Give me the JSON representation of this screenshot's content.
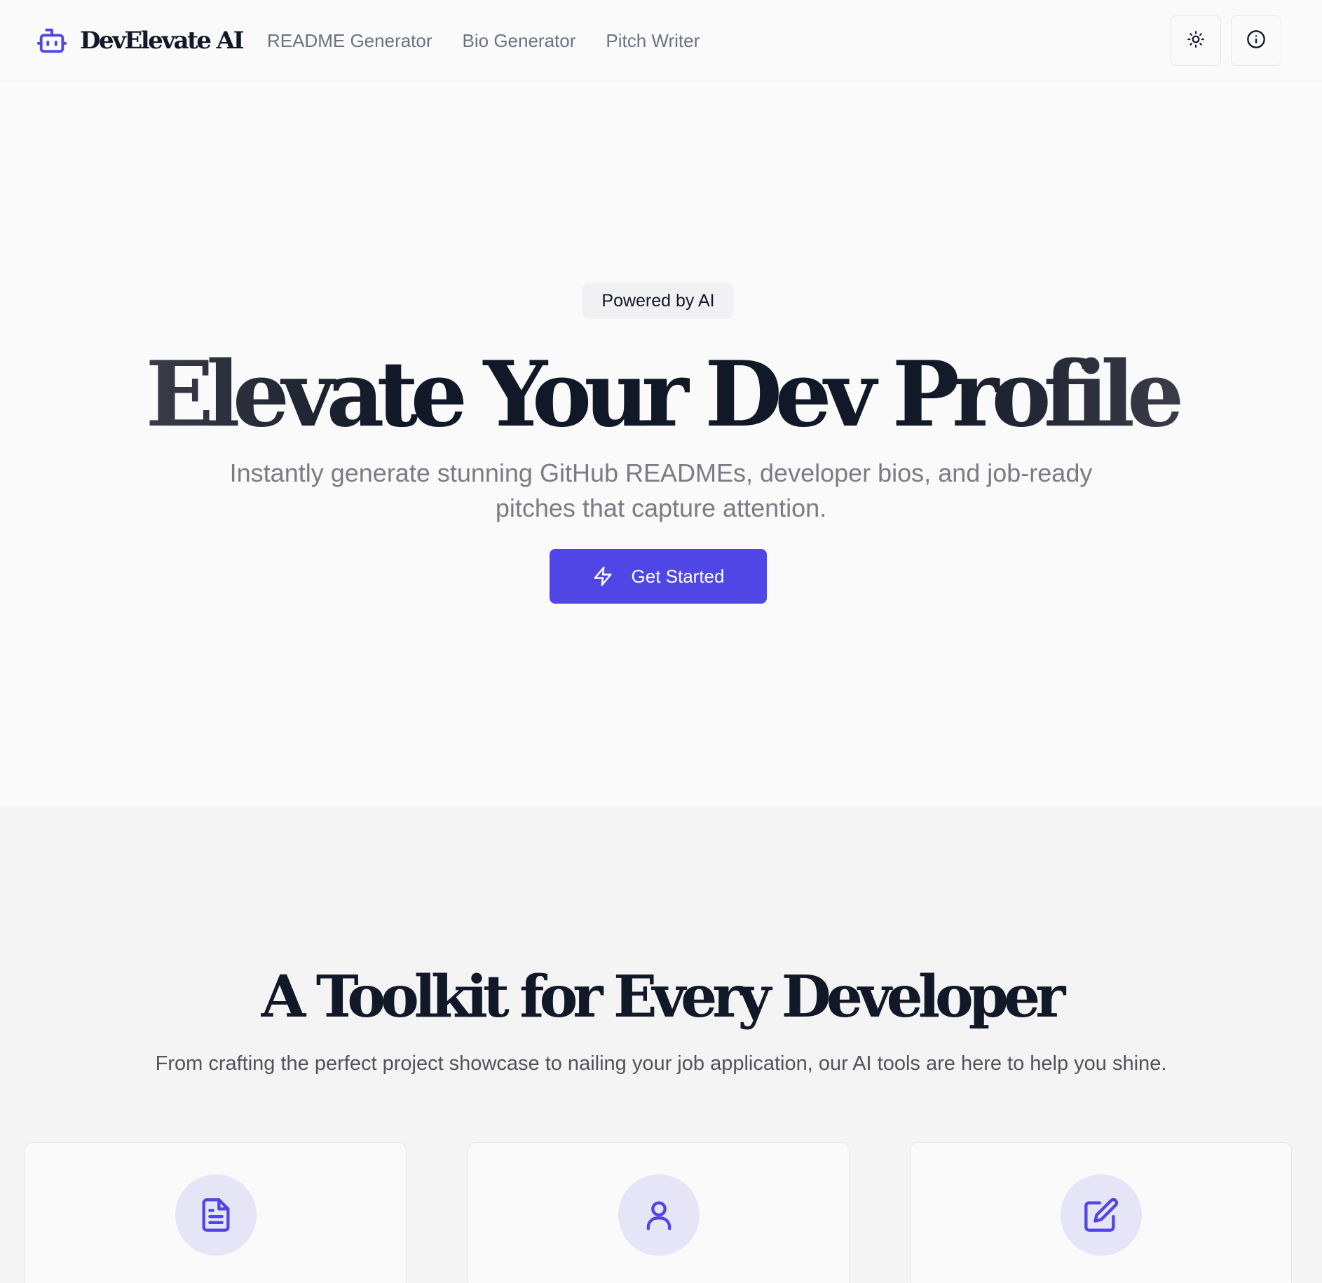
{
  "header": {
    "brand_name": "DevElevate AI",
    "brand_icon": "bot-icon",
    "nav": [
      "README Generator",
      "Bio Generator",
      "Pitch Writer"
    ],
    "theme_toggle_icon": "sun-icon",
    "info_icon": "info-icon"
  },
  "hero": {
    "badge": "Powered by AI",
    "title": "Elevate Your Dev Profile",
    "subtitle": "Instantly generate stunning GitHub READMEs, developer bios, and job-ready pitches that capture attention.",
    "cta_label": "Get Started",
    "cta_icon": "zap-icon"
  },
  "features": {
    "title": "A Toolkit for Every Developer",
    "subtitle": "From crafting the perfect project showcase to nailing your job application, our AI tools are here to help you shine.",
    "cards": [
      {
        "icon": "file-text-icon"
      },
      {
        "icon": "user-icon"
      },
      {
        "icon": "edit-icon"
      }
    ]
  },
  "colors": {
    "accent": "#4f46e5",
    "icon_circle": "#e6e5f7",
    "text_dark": "#111827",
    "text_muted": "#6b7280"
  }
}
